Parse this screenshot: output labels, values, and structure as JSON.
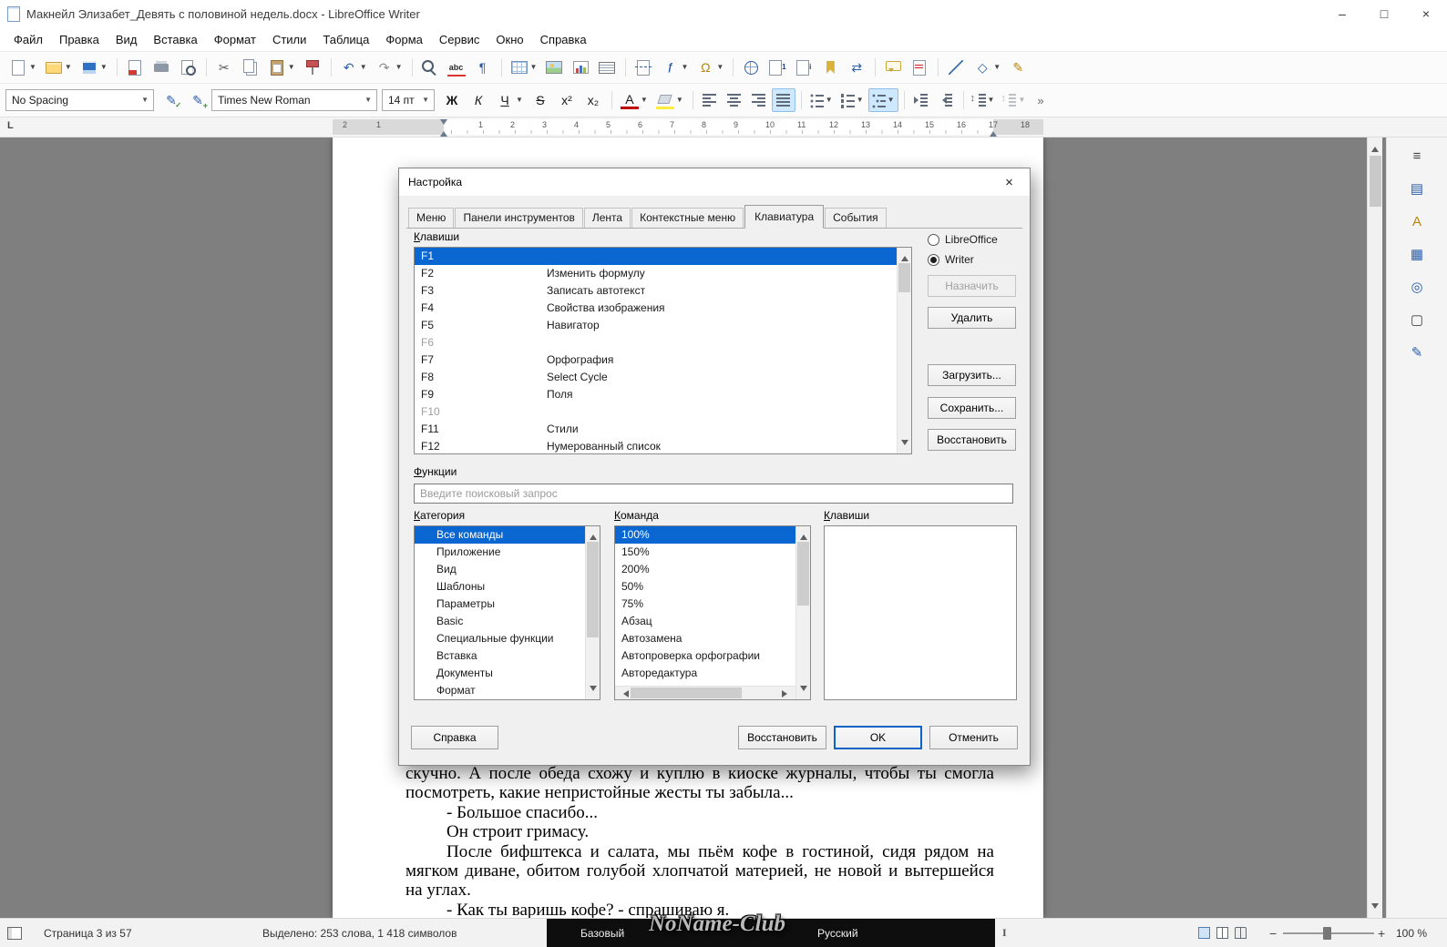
{
  "window": {
    "title": "Макнейл Элизабет_Девять с половиной недель.docx - LibreOffice Writer",
    "minimize": "–",
    "maximize": "□",
    "close": "×"
  },
  "menubar": [
    "Файл",
    "Правка",
    "Вид",
    "Вставка",
    "Формат",
    "Стили",
    "Таблица",
    "Форма",
    "Сервис",
    "Окно",
    "Справка"
  ],
  "toolbar_std": [
    {
      "name": "new-document",
      "cls": "i-page",
      "dd": true
    },
    {
      "name": "open",
      "cls": "i-folder",
      "dd": true
    },
    {
      "name": "save",
      "cls": "i-save",
      "dd": true
    },
    {
      "sep": true
    },
    {
      "name": "export-pdf",
      "cls": "i-pdf"
    },
    {
      "name": "print",
      "cls": "i-print"
    },
    {
      "name": "print-preview",
      "cls": "i-preview"
    },
    {
      "sep": true
    },
    {
      "name": "cut",
      "glyph": "✂",
      "color": "#5a5a5a"
    },
    {
      "name": "copy",
      "cls": "i-copy"
    },
    {
      "name": "paste",
      "cls": "i-paste",
      "dd": true
    },
    {
      "name": "clone-formatting",
      "cls": "i-clone"
    },
    {
      "sep": true
    },
    {
      "name": "undo",
      "glyph": "↶",
      "color": "#2a5caa",
      "dd": true
    },
    {
      "name": "redo",
      "glyph": "↷",
      "color": "#8a8a8a",
      "dd": true
    },
    {
      "sep": true
    },
    {
      "name": "find-replace",
      "cls": "i-find"
    },
    {
      "name": "spelling",
      "glyph": "abc",
      "cls": "i-spell"
    },
    {
      "name": "formatting-marks",
      "glyph": "¶",
      "color": "#2a5caa"
    },
    {
      "sep": true
    },
    {
      "name": "insert-table",
      "cls": "i-table",
      "dd": true
    },
    {
      "name": "insert-image",
      "cls": "i-image"
    },
    {
      "name": "insert-chart",
      "cls": "i-chart"
    },
    {
      "name": "insert-textbox",
      "cls": "i-textbox"
    },
    {
      "sep": true
    },
    {
      "name": "page-break",
      "cls": "i-pagebreak"
    },
    {
      "name": "insert-field",
      "glyph": "ƒ",
      "cls": "i-field",
      "dd": true
    },
    {
      "name": "special-character",
      "glyph": "Ω",
      "color": "#b8860b",
      "dd": true
    },
    {
      "sep": true
    },
    {
      "name": "hyperlink",
      "cls": "i-link"
    },
    {
      "name": "footnote",
      "glyph": "1",
      "cls": "i-note"
    },
    {
      "name": "endnote",
      "glyph": "i",
      "cls": "i-note"
    },
    {
      "name": "bookmark",
      "cls": "i-bookmark"
    },
    {
      "name": "cross-reference",
      "glyph": "⇄",
      "color": "#2a5caa"
    },
    {
      "sep": true
    },
    {
      "name": "comment",
      "cls": "i-comment"
    },
    {
      "name": "track-changes",
      "cls": "i-track"
    },
    {
      "sep": true
    },
    {
      "name": "line",
      "cls": "i-line"
    },
    {
      "name": "basic-shapes",
      "glyph": "◇",
      "color": "#2a5caa",
      "dd": true
    },
    {
      "name": "draw-functions",
      "glyph": "✎",
      "color": "#b8860b"
    }
  ],
  "formatting": {
    "style_combo": "No Spacing",
    "font_combo": "Times New Roman",
    "size_combo": "14 пт",
    "style_buttons": [
      {
        "name": "update-style",
        "glyph": "✎",
        "cls": "i-updstyle"
      },
      {
        "name": "new-style",
        "glyph": "✎",
        "cls": "i-newstyle"
      }
    ],
    "buttons": [
      {
        "name": "bold",
        "glyph": "Ж",
        "bold": true
      },
      {
        "name": "italic",
        "glyph": "К",
        "italic": true
      },
      {
        "name": "underline",
        "glyph": "Ч",
        "underline": true,
        "dd": true
      },
      {
        "name": "strikethrough",
        "glyph": "S",
        "strike": true
      },
      {
        "name": "superscript",
        "glyph": "x²"
      },
      {
        "name": "subscript",
        "glyph": "x₂"
      },
      {
        "sep": true
      },
      {
        "name": "font-color",
        "glyph": "A",
        "bar": "#c00000",
        "dd": true
      },
      {
        "name": "highlight-color",
        "cls": "i-highlight",
        "bar": "#ffec3d",
        "dd": true
      },
      {
        "sep": true
      },
      {
        "name": "align-left",
        "cls": "bars b-left"
      },
      {
        "name": "align-center",
        "cls": "bars b-center"
      },
      {
        "name": "align-right",
        "cls": "bars b-right"
      },
      {
        "name": "align-justify",
        "cls": "bars b-justify",
        "active": true
      },
      {
        "sep": true
      },
      {
        "name": "unordered-list",
        "cls": "b-ul",
        "dd": true
      },
      {
        "name": "ordered-list",
        "cls": "b-ol",
        "dd": true
      },
      {
        "name": "outline-list",
        "cls": "b-outline",
        "dd": true,
        "active": true
      },
      {
        "sep": true
      },
      {
        "name": "increase-indent",
        "cls": "bars b-ind-inc"
      },
      {
        "name": "decrease-indent",
        "cls": "bars b-ind-dec"
      },
      {
        "sep": true
      },
      {
        "name": "line-spacing",
        "cls": "bars b-lsp",
        "dd": true
      },
      {
        "name": "paragraph-spacing",
        "cls": "bars b-psp",
        "dd": true,
        "disabled": true
      }
    ],
    "overflow": "»"
  },
  "ruler": {
    "left_numbers": [
      "2",
      "1"
    ],
    "numbers": [
      "1",
      "2",
      "3",
      "4",
      "5",
      "6",
      "7",
      "8",
      "9",
      "10",
      "11",
      "12",
      "13",
      "14",
      "15",
      "16",
      "17",
      "18"
    ],
    "tabstop": "L"
  },
  "dialog": {
    "title": "Настройка",
    "close": "×",
    "tabs": [
      "Меню",
      "Панели инструментов",
      "Лента",
      "Контекстные меню",
      "Клавиатура",
      "События"
    ],
    "active_tab_index": 4,
    "keys_label": "Клавиши",
    "shortcuts": [
      {
        "key": "F1",
        "command": "",
        "selected": true
      },
      {
        "key": "F2",
        "command": "Изменить формулу"
      },
      {
        "key": "F3",
        "command": "Записать автотекст"
      },
      {
        "key": "F4",
        "command": "Свойства изображения"
      },
      {
        "key": "F5",
        "command": "Навигатор"
      },
      {
        "key": "F6",
        "command": "",
        "disabled": true
      },
      {
        "key": "F7",
        "command": "Орфография"
      },
      {
        "key": "F8",
        "command": "Select Cycle"
      },
      {
        "key": "F9",
        "command": "Поля"
      },
      {
        "key": "F10",
        "command": "",
        "disabled": true
      },
      {
        "key": "F11",
        "command": "Стили"
      },
      {
        "key": "F12",
        "command": "Нумерованный список"
      }
    ],
    "scope_options": [
      "LibreOffice",
      "Writer"
    ],
    "scope_selected": "Writer",
    "buttons": {
      "assign": "Назначить",
      "delete": "Удалить",
      "load": "Загрузить...",
      "save": "Сохранить...",
      "reset": "Восстановить"
    },
    "functions_label": "Функции",
    "search_placeholder": "Введите поисковый запрос",
    "category_label": "Категория",
    "command_label": "Команда",
    "keys2_label": "Клавиши",
    "categories": [
      "Все команды",
      "Приложение",
      "Вид",
      "Шаблоны",
      "Параметры",
      "Basic",
      "Специальные функции",
      "Вставка",
      "Документы",
      "Формат"
    ],
    "commands": [
      "100%",
      "150%",
      "200%",
      "50%",
      "75%",
      "Абзац",
      "Автозамена",
      "Автопроверка орфографии",
      "Авторедактура"
    ],
    "footer": {
      "help": "Справка",
      "reset": "Восстановить",
      "ok": "OK",
      "cancel": "Отменить"
    }
  },
  "document": {
    "paragraphs": [
      {
        "text": "скучно. А после обеда схожу и куплю в киоске журналы, чтобы ты смогла посмотреть, какие непристойные жесты ты забыла...",
        "justify": true,
        "indent": false
      },
      {
        "text": "- Большое спасибо...",
        "indent": true
      },
      {
        "text": "Он строит гримасу.",
        "indent": true
      },
      {
        "text": "После бифштекса и салата, мы пьём кофе в гостиной, сидя рядом на мягком диване, обитом голубой хлопчатой материей, не новой и вытершейся на углах.",
        "justify": true,
        "indent": true
      },
      {
        "text": "- Как ты варишь кофе? - спрашиваю я.",
        "indent": true
      }
    ]
  },
  "statusbar": {
    "page": "Страница 3 из 57",
    "selection": "Выделено: 253 слова, 1 418 символов",
    "style": "Базовый",
    "language": "Русский",
    "selection_mode": "I",
    "zoom_out": "−",
    "zoom_in": "+",
    "zoom": "100 %",
    "watermark": "NoName-Club"
  },
  "sidebar": [
    {
      "name": "sidebar-settings",
      "glyph": "≡",
      "color": "#444444"
    },
    {
      "name": "properties",
      "glyph": "▤",
      "color": "#2a5caa"
    },
    {
      "name": "styles",
      "glyph": "A",
      "color": "#b8860b"
    },
    {
      "name": "gallery",
      "glyph": "▦",
      "color": "#2a5caa"
    },
    {
      "name": "navigator",
      "glyph": "◎",
      "color": "#2a5caa"
    },
    {
      "name": "page",
      "glyph": "▢",
      "color": "#444444"
    },
    {
      "name": "style-inspector",
      "glyph": "✎",
      "color": "#2a5caa"
    }
  ]
}
